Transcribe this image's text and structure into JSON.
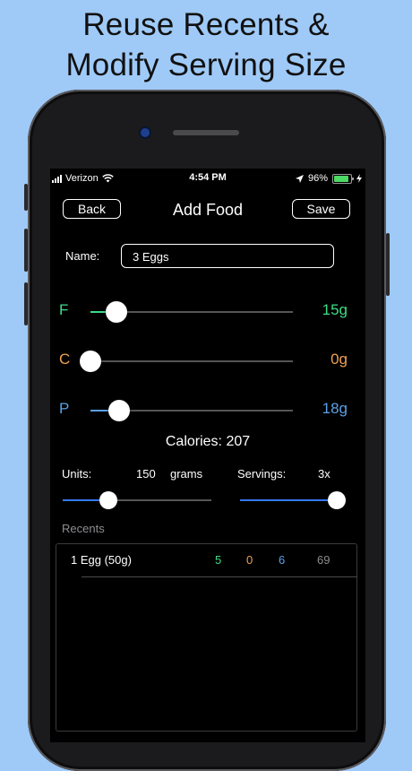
{
  "headline": {
    "line1": "Reuse Recents &",
    "line2": "Modify Serving Size"
  },
  "status_bar": {
    "carrier": "Verizon",
    "time": "4:54 PM",
    "battery": "96%"
  },
  "nav": {
    "back_label": "Back",
    "title": "Add Food",
    "save_label": "Save"
  },
  "form": {
    "name_label": "Name:",
    "name_value": "3 Eggs"
  },
  "macros": [
    {
      "letter": "F",
      "value": "15g",
      "color": "#3ddc84",
      "level": 0.13
    },
    {
      "letter": "C",
      "value": "0g",
      "color": "#f0a050",
      "level": 0.0
    },
    {
      "letter": "P",
      "value": "18g",
      "color": "#5aa0e6",
      "level": 0.14
    }
  ],
  "calories": "Calories: 207",
  "units": {
    "label": "Units:",
    "value": "150",
    "unit": "grams",
    "level": 0.31
  },
  "servings": {
    "label": "Servings:",
    "value": "3x",
    "level": 1.0
  },
  "recents": {
    "label": "Recents",
    "items": [
      {
        "name": "1 Egg (50g)",
        "fat": "5",
        "carbs": "0",
        "protein": "6",
        "calories": "69"
      }
    ]
  },
  "colors": {
    "fat": "#3ddc84",
    "carbs": "#f0a050",
    "protein": "#5aa0e6",
    "accent": "#3478f6",
    "background": "#9fcaf8"
  }
}
